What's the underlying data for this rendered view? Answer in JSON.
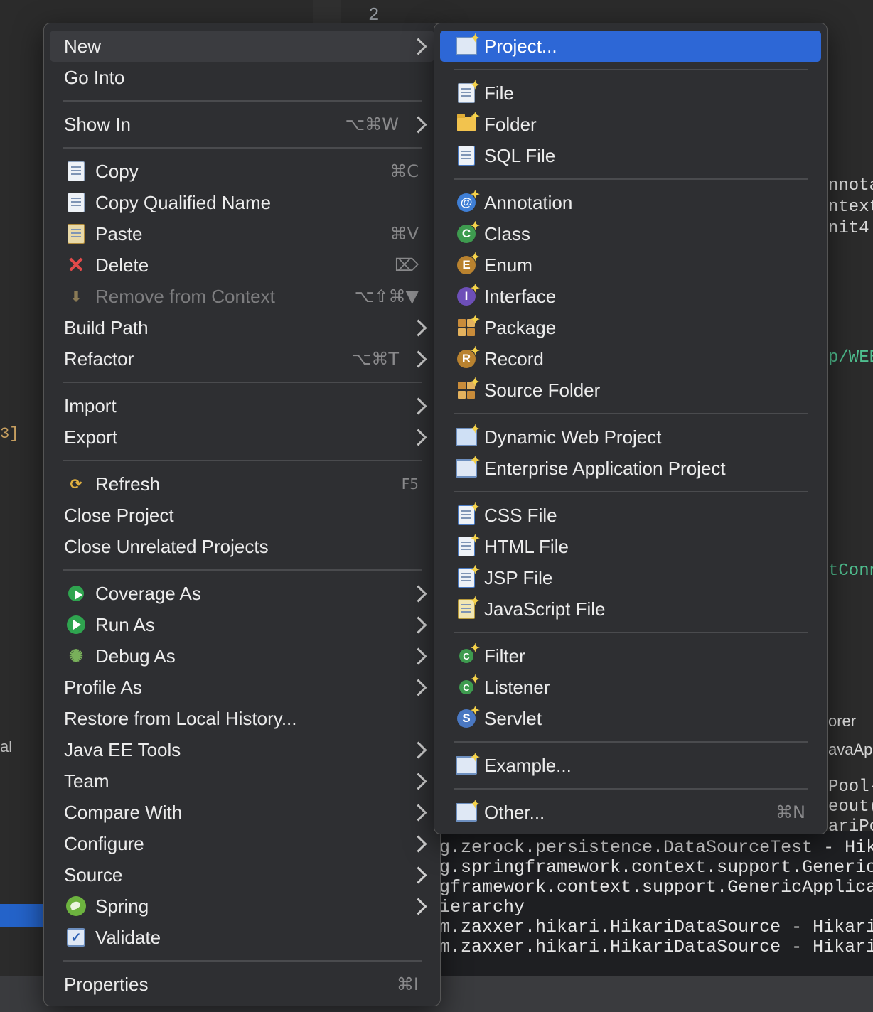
{
  "background": {
    "editor_line_number": "2",
    "side_snippets": [
      "nnota",
      "ntext",
      "nit4",
      "p/WEB",
      "tConn",
      "orer",
      "avaAp",
      "Pool-",
      "eout(",
      "ariPo"
    ],
    "left_snippets": [
      "3]",
      "al"
    ],
    "console_lines": [
      "g.zerock.persistence.DataSourceTest - Hikar",
      "g.springframework.context.support.GenericAp",
      "gframework.context.support.GenericApplicati",
      "ierarchy",
      "m.zaxxer.hikari.HikariDataSource - HikariPo",
      "m.zaxxer.hikari.HikariDataSource - HikariPo"
    ]
  },
  "main_menu": {
    "items": [
      {
        "label": "New",
        "icon": "",
        "shortcut": "",
        "submenu": true,
        "state": "highlighted"
      },
      {
        "label": "Go Into",
        "icon": "",
        "shortcut": "",
        "submenu": false
      },
      {
        "label": "Show In",
        "icon": "",
        "shortcut": "⌥⌘W",
        "submenu": true
      },
      {
        "label": "Copy",
        "icon": "copy-icon",
        "shortcut": "⌘C",
        "submenu": false
      },
      {
        "label": "Copy Qualified Name",
        "icon": "copy-qualified-icon",
        "shortcut": "",
        "submenu": false
      },
      {
        "label": "Paste",
        "icon": "paste-icon",
        "shortcut": "⌘V",
        "submenu": false
      },
      {
        "label": "Delete",
        "icon": "delete-icon",
        "shortcut": "⌦",
        "submenu": false
      },
      {
        "label": "Remove from Context",
        "icon": "remove-context-icon",
        "shortcut": "⌥⇧⌘▼",
        "submenu": false,
        "state": "disabled"
      },
      {
        "label": "Build Path",
        "icon": "",
        "shortcut": "",
        "submenu": true
      },
      {
        "label": "Refactor",
        "icon": "",
        "shortcut": "⌥⌘T",
        "submenu": true
      },
      {
        "label": "Import",
        "icon": "",
        "shortcut": "",
        "submenu": true
      },
      {
        "label": "Export",
        "icon": "",
        "shortcut": "",
        "submenu": true
      },
      {
        "label": "Refresh",
        "icon": "refresh-icon",
        "shortcut": "F5",
        "submenu": false
      },
      {
        "label": "Close Project",
        "icon": "",
        "shortcut": "",
        "submenu": false
      },
      {
        "label": "Close Unrelated Projects",
        "icon": "",
        "shortcut": "",
        "submenu": false
      },
      {
        "label": "Coverage As",
        "icon": "coverage-icon",
        "shortcut": "",
        "submenu": true
      },
      {
        "label": "Run As",
        "icon": "run-icon",
        "shortcut": "",
        "submenu": true
      },
      {
        "label": "Debug As",
        "icon": "debug-icon",
        "shortcut": "",
        "submenu": true
      },
      {
        "label": "Profile As",
        "icon": "",
        "shortcut": "",
        "submenu": true
      },
      {
        "label": "Restore from Local History...",
        "icon": "",
        "shortcut": "",
        "submenu": false
      },
      {
        "label": "Java EE Tools",
        "icon": "",
        "shortcut": "",
        "submenu": true
      },
      {
        "label": "Team",
        "icon": "",
        "shortcut": "",
        "submenu": true
      },
      {
        "label": "Compare With",
        "icon": "",
        "shortcut": "",
        "submenu": true
      },
      {
        "label": "Configure",
        "icon": "",
        "shortcut": "",
        "submenu": true
      },
      {
        "label": "Source",
        "icon": "",
        "shortcut": "",
        "submenu": true
      },
      {
        "label": "Spring",
        "icon": "spring-icon",
        "shortcut": "",
        "submenu": true
      },
      {
        "label": "Validate",
        "icon": "validate-icon",
        "shortcut": "",
        "submenu": false
      },
      {
        "label": "Properties",
        "icon": "",
        "shortcut": "⌘I",
        "submenu": false
      }
    ]
  },
  "new_submenu": {
    "items": [
      {
        "label": "Project...",
        "icon": "project-icon",
        "shortcut": "",
        "state": "selected"
      },
      {
        "label": "File",
        "icon": "file-icon",
        "shortcut": ""
      },
      {
        "label": "Folder",
        "icon": "folder-icon",
        "shortcut": ""
      },
      {
        "label": "SQL File",
        "icon": "sql-file-icon",
        "shortcut": ""
      },
      {
        "label": "Annotation",
        "icon": "annotation-icon",
        "shortcut": ""
      },
      {
        "label": "Class",
        "icon": "class-icon",
        "shortcut": ""
      },
      {
        "label": "Enum",
        "icon": "enum-icon",
        "shortcut": ""
      },
      {
        "label": "Interface",
        "icon": "interface-icon",
        "shortcut": ""
      },
      {
        "label": "Package",
        "icon": "package-icon",
        "shortcut": ""
      },
      {
        "label": "Record",
        "icon": "record-icon",
        "shortcut": ""
      },
      {
        "label": "Source Folder",
        "icon": "source-folder-icon",
        "shortcut": ""
      },
      {
        "label": "Dynamic Web Project",
        "icon": "dynamic-web-project-icon",
        "shortcut": ""
      },
      {
        "label": "Enterprise Application Project",
        "icon": "enterprise-project-icon",
        "shortcut": ""
      },
      {
        "label": "CSS File",
        "icon": "css-file-icon",
        "shortcut": ""
      },
      {
        "label": "HTML File",
        "icon": "html-file-icon",
        "shortcut": ""
      },
      {
        "label": "JSP File",
        "icon": "jsp-file-icon",
        "shortcut": ""
      },
      {
        "label": "JavaScript File",
        "icon": "javascript-file-icon",
        "shortcut": ""
      },
      {
        "label": "Filter",
        "icon": "filter-icon",
        "shortcut": ""
      },
      {
        "label": "Listener",
        "icon": "listener-icon",
        "shortcut": ""
      },
      {
        "label": "Servlet",
        "icon": "servlet-icon",
        "shortcut": ""
      },
      {
        "label": "Example...",
        "icon": "example-icon",
        "shortcut": ""
      },
      {
        "label": "Other...",
        "icon": "other-icon",
        "shortcut": "⌘N"
      }
    ]
  },
  "colors": {
    "selection": "#2d67d6",
    "menu_bg": "#2e2f32",
    "text": "#ececec",
    "disabled_text": "#7d7d7f"
  }
}
